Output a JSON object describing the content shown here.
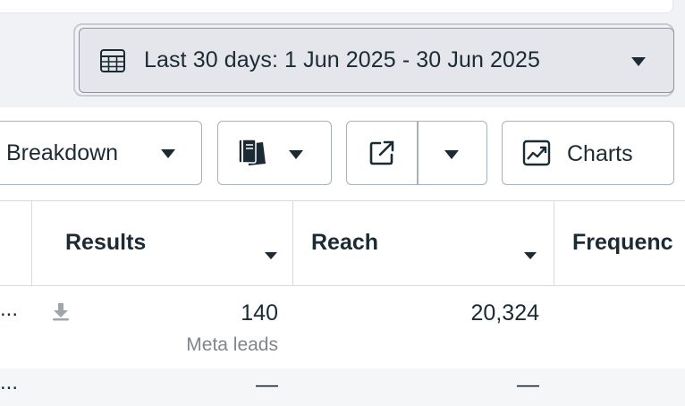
{
  "date_range": {
    "label": "Last 30 days: 1 Jun 2025 - 30 Jun 2025",
    "icon": "calendar-table-icon"
  },
  "toolbar": {
    "breakdown_label": "Breakdown",
    "reports_icon": "reports-stack-icon",
    "export_icon": "export-arrow-icon",
    "charts_label": "Charts",
    "charts_icon": "line-chart-icon"
  },
  "table": {
    "columns": [
      {
        "label": "Results"
      },
      {
        "label": "Reach"
      },
      {
        "label": "Frequenc"
      }
    ],
    "rows": [
      {
        "prefix": "...",
        "results": "140",
        "results_sub": "Meta leads",
        "reach": "20,324"
      },
      {
        "prefix": "...",
        "results": "—",
        "reach": "—"
      }
    ]
  },
  "colors": {
    "text": "#1c2b33",
    "border": "#a8b0ba",
    "muted": "#80868d",
    "date_bg": "#e4e6eb",
    "page_bg": "#f0f2f5"
  }
}
